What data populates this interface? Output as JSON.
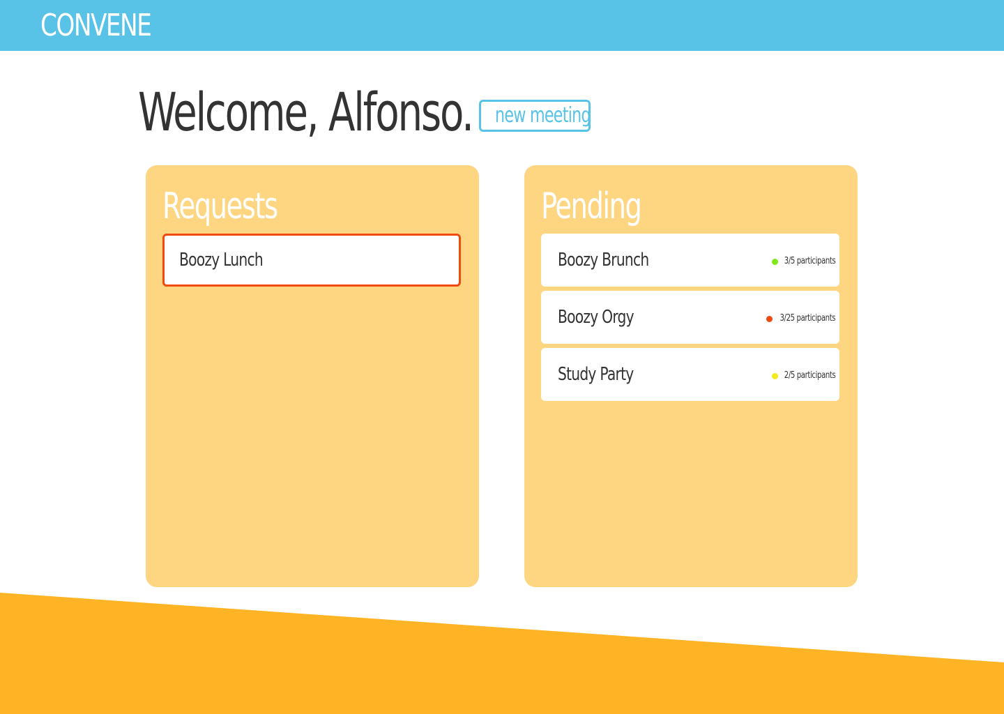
{
  "app": {
    "brand": "CONVENE"
  },
  "header": {
    "welcome": "Welcome, Alfonso.",
    "new_meeting_label": "new meeting"
  },
  "requests": {
    "title": "Requests",
    "items": [
      {
        "name": "Boozy Lunch",
        "selected": true
      }
    ]
  },
  "pending": {
    "title": "Pending",
    "items": [
      {
        "name": "Boozy Brunch",
        "participants": "3/5 participants",
        "status_color": "#7ee81a"
      },
      {
        "name": "Boozy Orgy",
        "participants": "3/25 participants",
        "status_color": "#f04a12"
      },
      {
        "name": "Study Party",
        "participants": "2/5 participants",
        "status_color": "#f2ea1a"
      }
    ]
  },
  "colors": {
    "topbar": "#58c3e6",
    "panel": "#fed581",
    "accent_bottom": "#feb424",
    "selected_border": "#f04a12",
    "text": "#333333"
  }
}
